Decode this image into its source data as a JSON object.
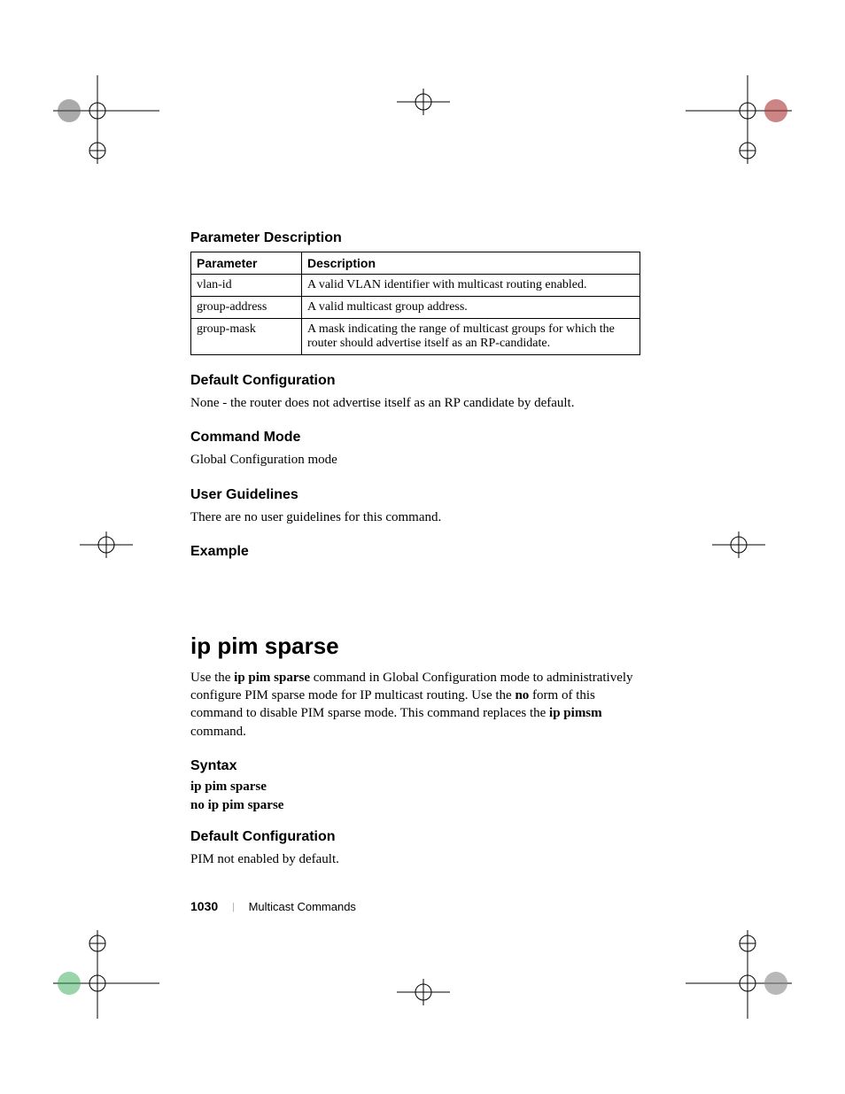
{
  "sections": {
    "param_desc": {
      "heading": "Parameter Description",
      "table": {
        "headers": [
          "Parameter",
          "Description"
        ],
        "rows": [
          {
            "param": "vlan-id",
            "desc": "A valid VLAN identifier with multicast routing enabled."
          },
          {
            "param": "group-address",
            "desc": "A valid multicast group address."
          },
          {
            "param": "group-mask",
            "desc": "A mask indicating the range of multicast groups for which the router should advertise itself as an RP-candidate."
          }
        ]
      }
    },
    "default_config_1": {
      "heading": "Default Configuration",
      "body": "None - the router does not advertise itself as an RP candidate by default."
    },
    "command_mode": {
      "heading": "Command Mode",
      "body": "Global Configuration mode"
    },
    "user_guidelines": {
      "heading": "User Guidelines",
      "body": "There are no user guidelines for this command."
    },
    "example": {
      "heading": "Example"
    },
    "cmd": {
      "heading": "ip pim sparse",
      "body_pre": "Use the ",
      "body_b1": "ip pim sparse",
      "body_mid1": " command in Global Configuration mode to administratively configure PIM sparse mode for IP multicast routing. Use the ",
      "body_b2": "no",
      "body_mid2": " form of this command to disable PIM sparse mode. This command replaces the ",
      "body_b3": "ip pimsm",
      "body_post": " command."
    },
    "syntax": {
      "heading": "Syntax",
      "line1": "ip pim sparse",
      "line2": "no ip pim sparse"
    },
    "default_config_2": {
      "heading": "Default Configuration",
      "body": "PIM not enabled by default."
    }
  },
  "footer": {
    "page": "1030",
    "section": "Multicast Commands"
  }
}
